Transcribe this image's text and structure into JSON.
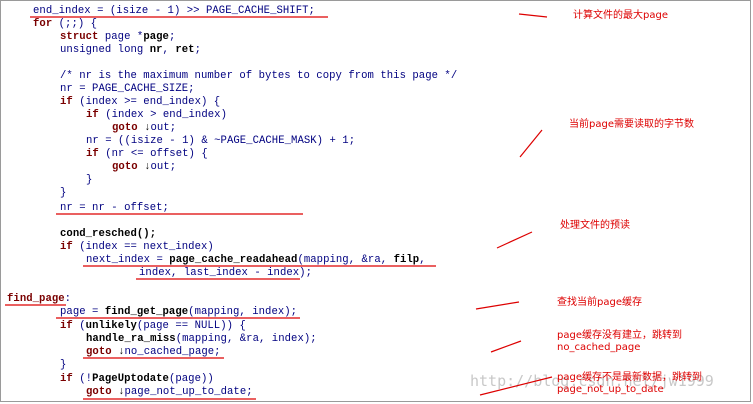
{
  "code": {
    "l1": "end_index = (isize - 1) >> PAGE_CACHE_SHIFT;",
    "l2_kw": "for",
    "l2_rest": " (;;) {",
    "l3_kw": "struct",
    "l3_rest": " page *",
    "l3_var": "page",
    "l3_end": ";",
    "l4_a": "unsigned long ",
    "l4_b": "nr",
    "l4_c": ", ",
    "l4_d": "ret",
    "l4_e": ";",
    "l5": "/* nr is the maximum number of bytes to copy from this page */",
    "l6": "nr = PAGE_CACHE_SIZE;",
    "l7_kw": "if",
    "l7_rest": " (index >= end_index) {",
    "l8_kw": "if",
    "l8_rest": " (index > end_index)",
    "l9_kw": "goto",
    "l9_rest": "out;",
    "l10": "nr = ((isize - 1) & ~PAGE_CACHE_MASK) + 1;",
    "l11_kw": "if",
    "l11_rest": " (nr <= offset) {",
    "l12_kw": "goto",
    "l12_rest": "out;",
    "l13": "}",
    "l14": "}",
    "l15": "nr = nr - offset;",
    "l16": "cond_resched();",
    "l17_kw": "if",
    "l17_rest": " (index == next_index)",
    "l18_a": "next_index = ",
    "l18_fn": "page_cache_readahead",
    "l18_b": "(mapping, &ra, ",
    "l18_c": "filp",
    "l18_d": ",",
    "l19": "index, last_index - index);",
    "l20_label": "find_page",
    "l20_colon": ":",
    "l21_a": "page = ",
    "l21_fn": "find_get_page",
    "l21_b": "(mapping, index);",
    "l22_kw": "if",
    "l22_a": " (",
    "l22_fn": "unlikely",
    "l22_b": "(page == NULL)) {",
    "l23_fn": "handle_ra_miss",
    "l23_b": "(mapping, &ra, index);",
    "l24_kw": "goto",
    "l24_rest": "no_cached_page;",
    "l25": "}",
    "l26_kw": "if",
    "l26_a": " (!",
    "l26_fn": "PageUptodate",
    "l26_b": "(page))",
    "l27_kw": "goto",
    "l27_rest": "page_not_up_to_date;",
    "arrow": "↓"
  },
  "notes": {
    "n1": "计算文件的最大page",
    "n2": "当前page需要读取的字节数",
    "n3": "处理文件的预读",
    "n4": "查找当前page缓存",
    "n5a": "page缓存没有建立，跳转到",
    "n5b": "no_cached_page",
    "n6a": "page缓存不是最新数据，跳转到",
    "n6b": "page_not_up_to_date"
  },
  "watermark": "http://blog.csdn.net/jw1999",
  "colors": {
    "annotation": "#dd0000",
    "plain_code": "#000080",
    "keyword": "#7a0000"
  }
}
